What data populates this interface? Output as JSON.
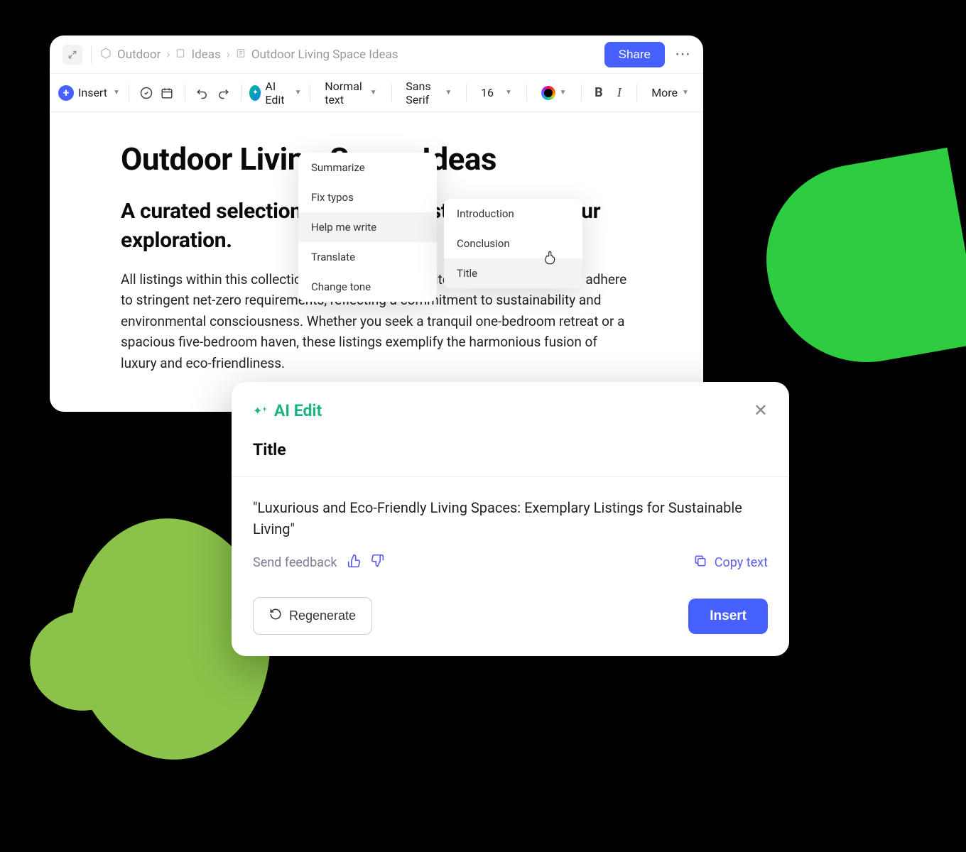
{
  "breadcrumb": {
    "level1": "Outdoor",
    "level2": "Ideas",
    "level3": "Outdoor Living Space Ideas"
  },
  "topbar": {
    "share_label": "Share"
  },
  "toolbar": {
    "insert_label": "Insert",
    "ai_edit_label": "AI Edit",
    "style_label": "Normal text",
    "font_label": "Sans Serif",
    "font_size": "16",
    "more_label": "More"
  },
  "ai_menu": {
    "items": [
      "Summarize",
      "Fix typos",
      "Help me write",
      "Translate",
      "Change tone"
    ],
    "active_index": 2
  },
  "help_write_menu": {
    "items": [
      "Introduction",
      "Conclusion",
      "Title"
    ],
    "active_index": 2
  },
  "document": {
    "title": "Outdoor Living Space Ideas",
    "subtitle": "A curated selection of available listings awaits your exploration.",
    "paragraph": "All listings within this collection not only offer exquisite living spaces but also adhere to stringent net-zero requirements, reflecting a commitment to sustainability and environmental consciousness. Whether you seek a tranquil one-bedroom retreat or a spacious five-bedroom haven, these listings exemplify the harmonious fusion of luxury and eco-friendliness."
  },
  "ai_panel": {
    "header_label": "AI Edit",
    "section_title": "Title",
    "generated_text": "\"Luxurious and Eco-Friendly Living Spaces: Exemplary Listings for Sustainable Living\"",
    "feedback_label": "Send feedback",
    "copy_label": "Copy text",
    "regenerate_label": "Regenerate",
    "insert_label": "Insert"
  }
}
